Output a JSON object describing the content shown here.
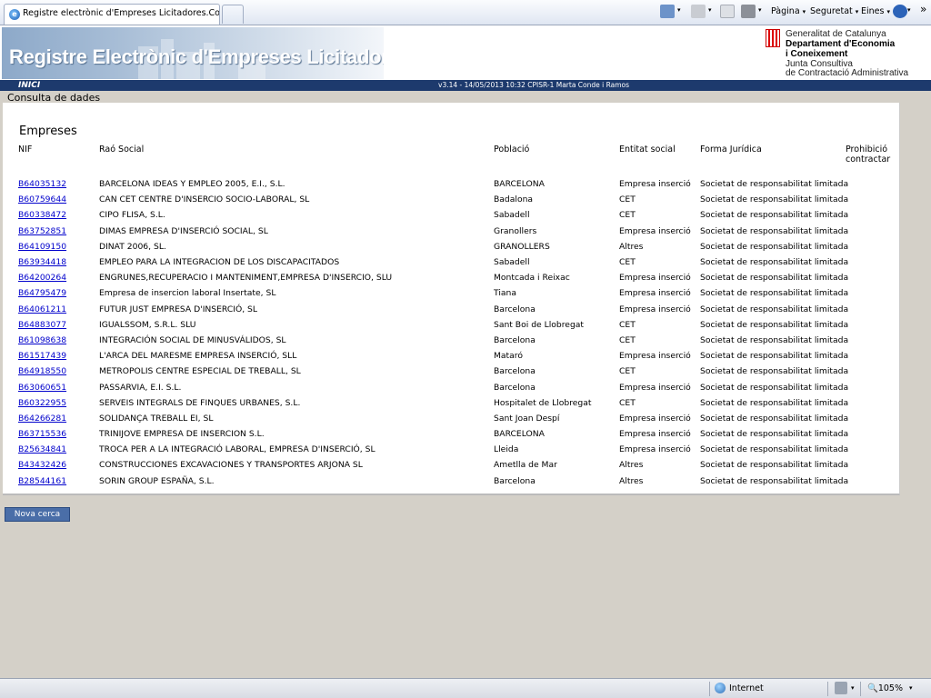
{
  "browser": {
    "tab_title": "Registre electrònic d'Empreses Licitadores.Consulta A...",
    "cmd_pagina": "Pàgina",
    "cmd_seguretat": "Seguretat",
    "cmd_eines": "Eines",
    "cmd_more": "»",
    "caret": "▾"
  },
  "banner": {
    "title": "Registre Electrònic d'Empreses Licitadores",
    "gen_line1": "Generalitat de Catalunya",
    "gen_line2": "Departament d'Economia",
    "gen_line3": "i Coneixement",
    "gen_line4": "Junta Consultiva",
    "gen_line5": "de Contractació Administrativa"
  },
  "nav": {
    "inici": "INICI",
    "version": "v3.14 - 14/05/2013 10:32 CPISR-1 Marta Conde i Ramos"
  },
  "page": {
    "breadcrumb": "Consulta de dades",
    "section_title": "Empreses",
    "new_search_button": "Nova cerca"
  },
  "table": {
    "headers": {
      "nif": "NIF",
      "rao": "Raó Social",
      "poblacio": "Població",
      "entitat": "Entitat social",
      "forma": "Forma Jurídica",
      "prohibicio1": "Prohibició",
      "prohibicio2": "contractar"
    },
    "rows": [
      {
        "nif": "B64035132",
        "rao": "BARCELONA IDEAS Y EMPLEO 2005, E.I., S.L.",
        "poblacio": "BARCELONA",
        "entitat": "Empresa inserció",
        "forma": "Societat de responsabilitat limitada"
      },
      {
        "nif": "B60759644",
        "rao": "CAN CET CENTRE D'INSERCIO SOCIO-LABORAL, SL",
        "poblacio": "Badalona",
        "entitat": "CET",
        "forma": "Societat de responsabilitat limitada"
      },
      {
        "nif": "B60338472",
        "rao": "CIPO FLISA, S.L.",
        "poblacio": "Sabadell",
        "entitat": "CET",
        "forma": "Societat de responsabilitat limitada"
      },
      {
        "nif": "B63752851",
        "rao": "DIMAS EMPRESA D'INSERCIÓ SOCIAL, SL",
        "poblacio": "Granollers",
        "entitat": "Empresa inserció",
        "forma": "Societat de responsabilitat limitada"
      },
      {
        "nif": "B64109150",
        "rao": "DINAT 2006, SL.",
        "poblacio": "GRANOLLERS",
        "entitat": "Altres",
        "forma": "Societat de responsabilitat limitada"
      },
      {
        "nif": "B63934418",
        "rao": "EMPLEO PARA LA INTEGRACION DE LOS DISCAPACITADOS",
        "poblacio": "Sabadell",
        "entitat": "CET",
        "forma": "Societat de responsabilitat limitada"
      },
      {
        "nif": "B64200264",
        "rao": "ENGRUNES,RECUPERACIO I MANTENIMENT,EMPRESA D'INSERCIO, SLU",
        "poblacio": "Montcada i Reixac",
        "entitat": "Empresa inserció",
        "forma": "Societat de responsabilitat limitada"
      },
      {
        "nif": "B64795479",
        "rao": "Empresa de insercion laboral Insertate, SL",
        "poblacio": "Tiana",
        "entitat": "Empresa inserció",
        "forma": "Societat de responsabilitat limitada"
      },
      {
        "nif": "B64061211",
        "rao": "FUTUR JUST EMPRESA D'INSERCIÓ, SL",
        "poblacio": "Barcelona",
        "entitat": "Empresa inserció",
        "forma": "Societat de responsabilitat limitada"
      },
      {
        "nif": "B64883077",
        "rao": "IGUALSSOM, S.R.L. SLU",
        "poblacio": "Sant Boi de Llobregat",
        "entitat": "CET",
        "forma": "Societat de responsabilitat limitada"
      },
      {
        "nif": "B61098638",
        "rao": "INTEGRACIÓN SOCIAL DE MINUSVÁLIDOS, SL",
        "poblacio": "Barcelona",
        "entitat": "CET",
        "forma": "Societat de responsabilitat limitada"
      },
      {
        "nif": "B61517439",
        "rao": "L'ARCA DEL MARESME EMPRESA INSERCIÓ, SLL",
        "poblacio": "Mataró",
        "entitat": "Empresa inserció",
        "forma": "Societat de responsabilitat limitada"
      },
      {
        "nif": "B64918550",
        "rao": "METROPOLIS CENTRE ESPECIAL DE TREBALL, SL",
        "poblacio": "Barcelona",
        "entitat": "CET",
        "forma": "Societat de responsabilitat limitada"
      },
      {
        "nif": "B63060651",
        "rao": "PASSARVIA, E.I. S.L.",
        "poblacio": "Barcelona",
        "entitat": "Empresa inserció",
        "forma": "Societat de responsabilitat limitada"
      },
      {
        "nif": "B60322955",
        "rao": "SERVEIS INTEGRALS DE FINQUES URBANES, S.L.",
        "poblacio": "Hospitalet de Llobregat",
        "entitat": "CET",
        "forma": "Societat de responsabilitat limitada"
      },
      {
        "nif": "B64266281",
        "rao": "SOLIDANÇA TREBALL EI, SL",
        "poblacio": "Sant Joan Despí",
        "entitat": "Empresa inserció",
        "forma": "Societat de responsabilitat limitada"
      },
      {
        "nif": "B63715536",
        "rao": "TRINIJOVE EMPRESA DE INSERCION S.L.",
        "poblacio": "BARCELONA",
        "entitat": "Empresa inserció",
        "forma": "Societat de responsabilitat limitada"
      },
      {
        "nif": "B25634841",
        "rao": "TROCA PER A LA INTEGRACIÓ LABORAL, EMPRESA D'INSERCIÓ, SL",
        "poblacio": "Lleida",
        "entitat": "Empresa inserció",
        "forma": "Societat de responsabilitat limitada"
      },
      {
        "nif": "B43432426",
        "rao": "CONSTRUCCIONES EXCAVACIONES Y TRANSPORTES ARJONA SL",
        "poblacio": "Ametlla de Mar",
        "entitat": "Altres",
        "forma": "Societat de responsabilitat limitada"
      },
      {
        "nif": "B28544161",
        "rao": "SORIN GROUP ESPAÑA, S.L.",
        "poblacio": "Barcelona",
        "entitat": "Altres",
        "forma": "Societat de responsabilitat limitada"
      }
    ]
  },
  "statusbar": {
    "zone": "Internet",
    "zoom": "105%",
    "caret": "▾"
  },
  "colors": {
    "nav_bg": "#1d3a6d",
    "link": "#0000cc",
    "button_bg": "#4a6ea8"
  }
}
